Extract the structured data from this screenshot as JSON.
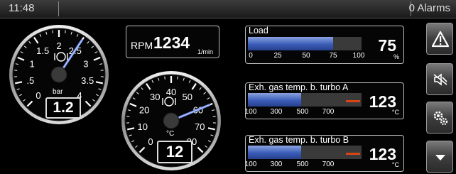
{
  "topbar": {
    "time": "11:48",
    "alarms": "0 Alarms"
  },
  "gauge_boost": {
    "ticks": [
      "0",
      ".5",
      "1",
      "1.5",
      "2",
      "2.5",
      "3",
      "3.5",
      "4"
    ],
    "unit": "bar",
    "value": "1.2",
    "needle_value": 2.5,
    "min": 0,
    "max": 4
  },
  "gauge_temp": {
    "ticks": [
      "0",
      "10",
      "20",
      "30",
      "40",
      "50",
      "60",
      "70",
      "80"
    ],
    "unit": "°C",
    "value": "12",
    "needle_value": 60,
    "min": 0,
    "max": 80
  },
  "rpm": {
    "label": "RPM",
    "value": "1234",
    "unit": "1/min"
  },
  "load": {
    "title": "Load",
    "value": "75",
    "unit": "%",
    "fill_fraction": 0.75,
    "scale": [
      "0",
      "25",
      "50",
      "75",
      "100"
    ]
  },
  "exh_a": {
    "title": "Exh. gas temp. b. turbo A",
    "value": "123",
    "unit": "°C",
    "fill_fraction": 0.47,
    "scale": [
      "100",
      "300",
      "500",
      "700"
    ]
  },
  "exh_b": {
    "title": "Exh. gas temp. b. turbo B",
    "value": "123",
    "unit": "°C",
    "fill_fraction": 0.47,
    "scale": [
      "100",
      "300",
      "500",
      "700"
    ]
  },
  "side_buttons": [
    {
      "icon": "warning-icon"
    },
    {
      "icon": "mute-alarm-icon"
    },
    {
      "icon": "settings-gears-icon"
    },
    {
      "icon": "scroll-down-icon"
    }
  ],
  "colors": {
    "bar_fill": "#3b5cb8",
    "needle": "#6f8ff0",
    "warning_band": "#d84515",
    "button": "#4a4a4a"
  }
}
